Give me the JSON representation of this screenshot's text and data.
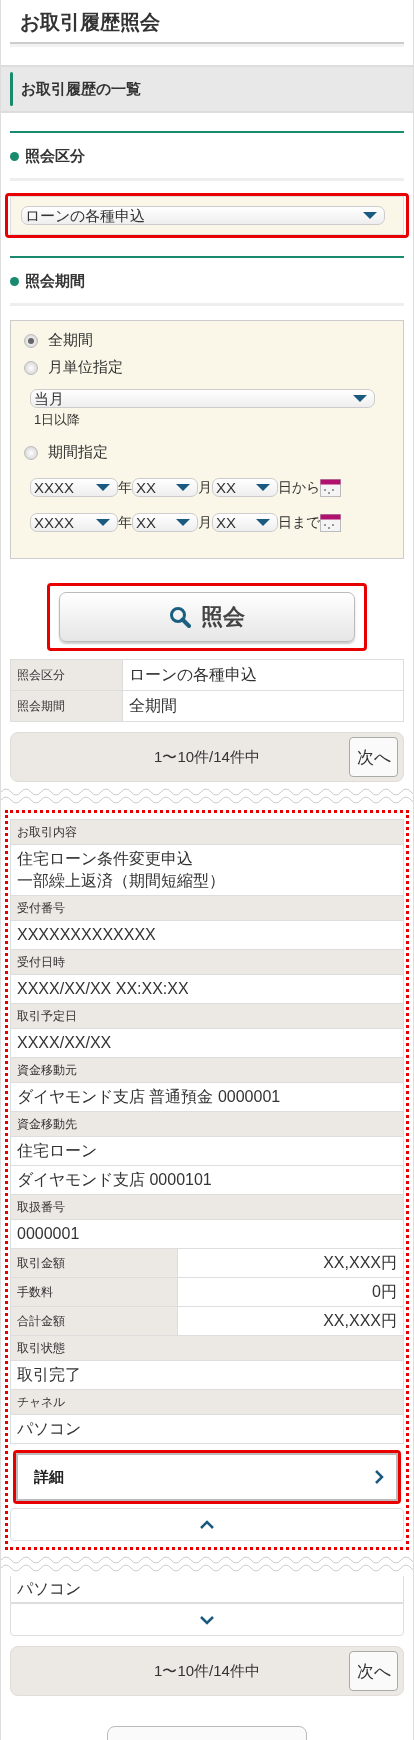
{
  "page_title": "お取引履歴照会",
  "section_title": "お取引履歴の一覧",
  "inquiry_type": {
    "heading": "照会区分",
    "select": {
      "value": "ローンの各種申込",
      "highlighted": true
    }
  },
  "inquiry_period": {
    "heading": "照会期間",
    "options": [
      {
        "label": "全期間",
        "selected": true
      },
      {
        "label": "月単位指定",
        "selected": false
      },
      {
        "label": "期間指定",
        "selected": false
      }
    ],
    "month_select": {
      "value": "当月"
    },
    "month_note": "1日以降",
    "range": [
      {
        "year": "XXXX",
        "year_unit": "年",
        "month": "XX",
        "month_unit": "月",
        "day": "XX",
        "suffix": "日から"
      },
      {
        "year": "XXXX",
        "year_unit": "年",
        "month": "XX",
        "month_unit": "月",
        "day": "XX",
        "suffix": "日まで"
      }
    ]
  },
  "search_button": {
    "label": "照会",
    "highlighted": true
  },
  "summary": [
    {
      "label": "照会区分",
      "value": "ローンの各種申込"
    },
    {
      "label": "照会期間",
      "value": "全期間"
    }
  ],
  "pager_top": {
    "text": "1〜10件/14件中",
    "next": "次へ"
  },
  "record": {
    "highlighted": true,
    "fields": [
      {
        "kind": "stacked",
        "label": "お取引内容",
        "values": [
          [
            "住宅ローン条件変更申込",
            "一部繰上返済（期間短縮型）"
          ]
        ]
      },
      {
        "kind": "stacked",
        "label": "受付番号",
        "values": [
          "XXXXXXXXXXXXX"
        ]
      },
      {
        "kind": "stacked",
        "label": "受付日時",
        "values": [
          "XXXX/XX/XX XX:XX:XX"
        ]
      },
      {
        "kind": "stacked",
        "label": "取引予定日",
        "values": [
          "XXXX/XX/XX"
        ]
      },
      {
        "kind": "stacked",
        "label": "資金移動元",
        "values": [
          "ダイヤモンド支店 普通預金 0000001"
        ]
      },
      {
        "kind": "stacked",
        "label": "資金移動先",
        "values": [
          "住宅ローン",
          "ダイヤモンド支店 0000101"
        ]
      },
      {
        "kind": "stacked",
        "label": "取扱番号",
        "values": [
          "0000001"
        ]
      },
      {
        "kind": "inline",
        "label": "取引金額",
        "value": "XX,XXX円"
      },
      {
        "kind": "inline",
        "label": "手数料",
        "value": "0円"
      },
      {
        "kind": "inline",
        "label": "合計金額",
        "value": "XX,XXX円"
      },
      {
        "kind": "stacked",
        "label": "取引状態",
        "values": [
          "取引完了"
        ]
      },
      {
        "kind": "stacked",
        "label": "チャネル",
        "values": [
          "パソコン"
        ]
      }
    ],
    "detail_button": {
      "label": "詳細",
      "highlighted": true
    }
  },
  "next_record": {
    "partial_value": "パソコン"
  },
  "pager_bottom": {
    "text": "1〜10件/14件中",
    "next": "次へ"
  }
}
